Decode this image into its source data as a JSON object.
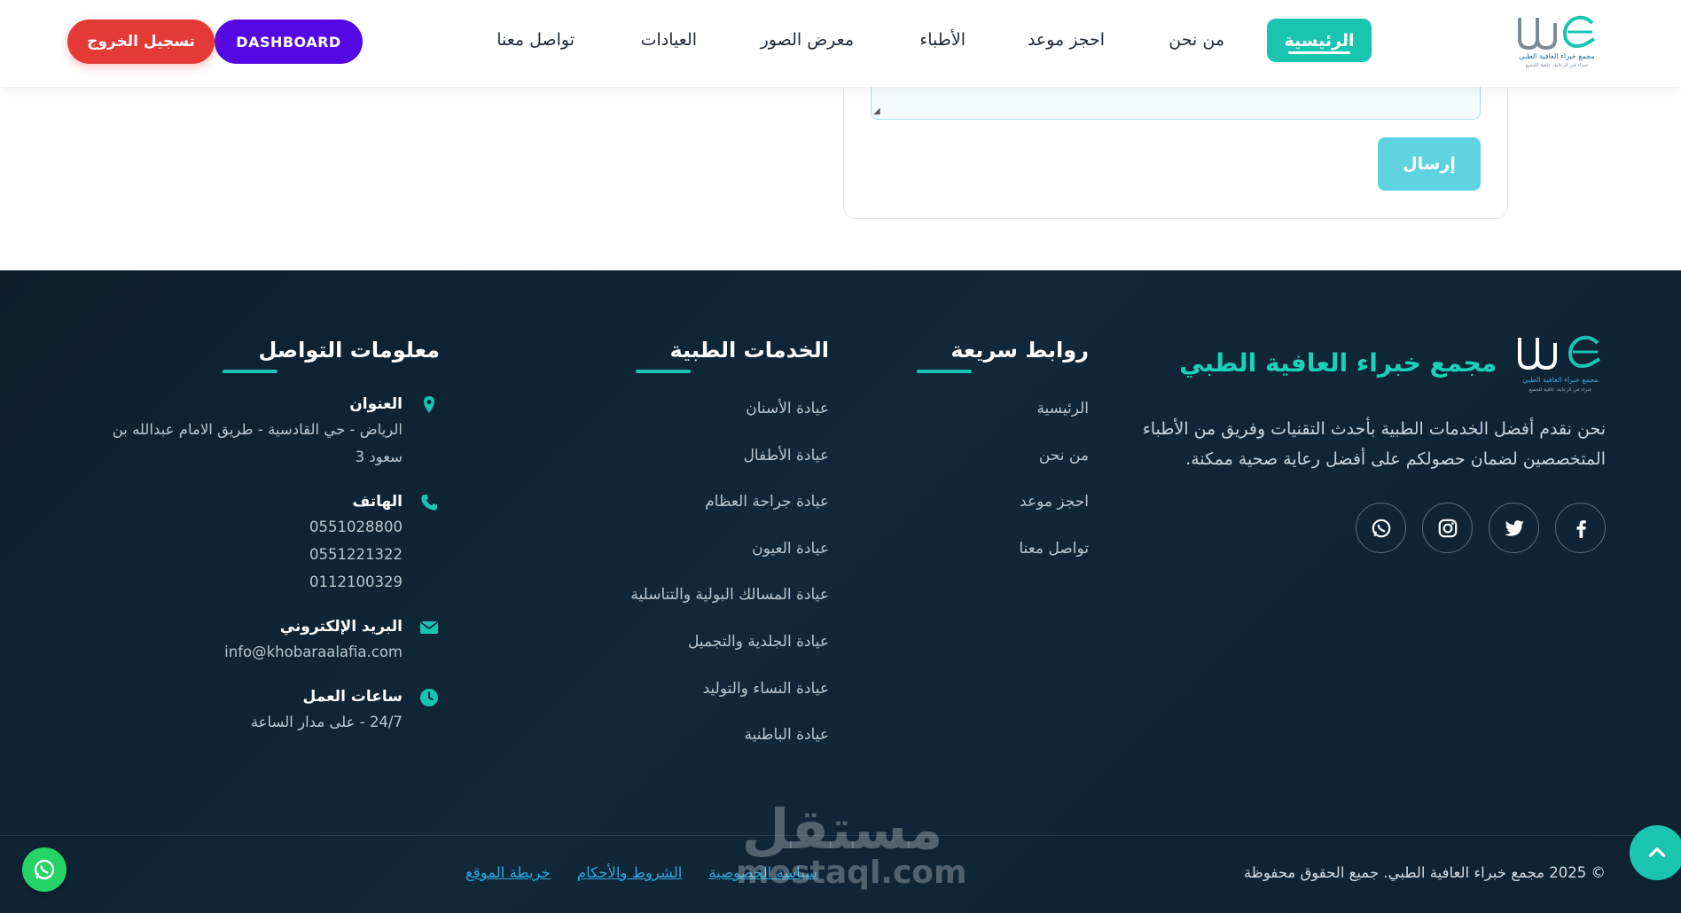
{
  "colors": {
    "accent": "#19c5b0",
    "dashboard": "#5508e3",
    "logout": "#e53935",
    "footer_bg": "#0f2536",
    "link": "#2da6d9",
    "whatsapp": "#25d366"
  },
  "logo": {
    "line1": "مجمع خبراء العافية الطبي",
    "line2": "خبراء في الرعاية، عافية للجميع"
  },
  "nav": {
    "home": "الرئيسية",
    "about": "من نحن",
    "booking": "احجز موعد",
    "doctors": "الأطباء",
    "gallery": "معرض الصور",
    "clinics": "العيادات",
    "contact": "تواصل معنا",
    "dashboard": "DASHBOARD",
    "logout": "تسجيل الخروج"
  },
  "form": {
    "submit": "إرسال"
  },
  "footer": {
    "brand": "مجمع خبراء العافية الطبي",
    "description": "نحن نقدم أفضل الخدمات الطبية بأحدث التقنيات وفريق من الأطباء المتخصصين لضمان حصولكم على أفضل رعاية صحية ممكنة.",
    "socials": [
      "facebook-icon",
      "twitter-icon",
      "instagram-icon",
      "whatsapp-icon"
    ],
    "quick_links": {
      "title": "روابط سريعة",
      "items": [
        "الرئيسية",
        "من نحن",
        "احجز موعد",
        "تواصل معنا"
      ]
    },
    "services": {
      "title": "الخدمات الطبية",
      "items": [
        "عيادة الأسنان",
        "عيادة الأطفال",
        "عيادة جراحة العظام",
        "عيادة العيون",
        "عيادة المسالك البولية والتناسلية",
        "عيادة الجلدية والتجميل",
        "عيادة النساء والتوليد",
        "عيادة الباطنية"
      ]
    },
    "contact": {
      "title": "معلومات التواصل",
      "address_label": "العنوان",
      "address": "الرياض - حي القادسية - طريق الامام عبدالله بن سعود 3",
      "phone_label": "الهاتف",
      "phones": [
        "0551028800",
        "0551221322",
        "0112100329"
      ],
      "email_label": "البريد الإلكتروني",
      "email": "info@khobaraalafia.com",
      "hours_label": "ساعات العمل",
      "hours": "24/7 - على مدار الساعة"
    },
    "copyright": "© 2025 مجمع خبراء العافية الطبي. جميع الحقوق محفوظة",
    "bottom_links": [
      "سياسة الخصوصية",
      "الشروط والأحكام",
      "خريطة الموقع"
    ]
  },
  "watermark": {
    "arabic": "مستقل",
    "latin": "mostaql.com"
  }
}
